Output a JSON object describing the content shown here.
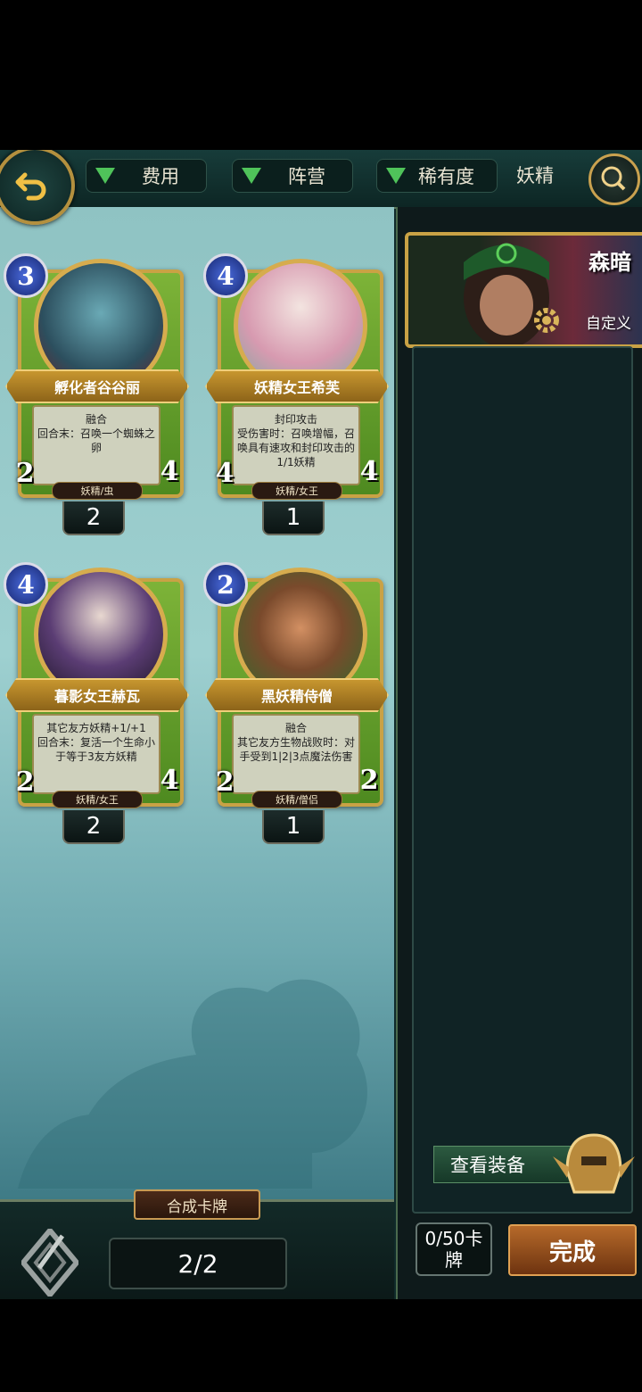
{
  "filters": {
    "cost_label": "费用",
    "faction_label": "阵营",
    "rarity_label": "稀有度",
    "tribe_value": "妖精"
  },
  "cards": [
    {
      "cost": "3",
      "name": "孵化者谷谷丽",
      "text": "融合\n回合末：召唤一个蜘蛛之卵",
      "attack": "2",
      "health": "4",
      "race": "妖精/虫",
      "count": "2"
    },
    {
      "cost": "4",
      "name": "妖精女王希芙",
      "text": "封印攻击\n受伤害时：召唤增幅，召唤具有速攻和封印攻击的1/1妖精",
      "attack": "4",
      "health": "4",
      "race": "妖精/女王",
      "count": "1"
    },
    {
      "cost": "4",
      "name": "暮影女王赫瓦",
      "text": "其它友方妖精+1/+1\n回合末：复活一个生命小于等于3友方妖精",
      "attack": "2",
      "health": "4",
      "race": "妖精/女王",
      "count": "2"
    },
    {
      "cost": "2",
      "name": "黑妖精侍僧",
      "text": "融合\n其它友方生物战败时：对手受到1|2|3点魔法伤害",
      "attack": "2",
      "health": "2",
      "race": "妖精/僧侣",
      "count": "1"
    }
  ],
  "hero": {
    "name": "森暗",
    "custom_label": "自定义"
  },
  "equip_button": "查看装备",
  "deck_count": "0/50卡牌",
  "done_button": "完成",
  "craft_label": "合成卡牌",
  "page_indicator": "2/2",
  "colors": {
    "accent_gold": "#c9a245",
    "filter_green": "#4fc35a",
    "done_orange": "#b66a2a"
  }
}
